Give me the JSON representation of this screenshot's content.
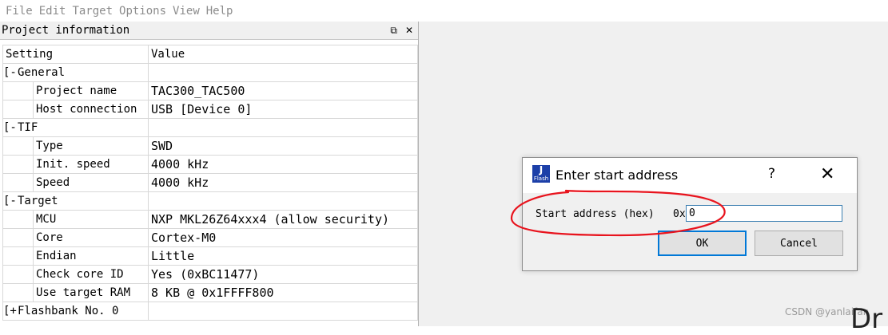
{
  "menu": [
    "File",
    "Edit",
    "Target",
    "Options",
    "View",
    "Help"
  ],
  "panel": {
    "title": "Project information",
    "restore_glyph": "⧉",
    "close_glyph": "✕"
  },
  "table": {
    "headers": [
      "Setting",
      "Value"
    ],
    "groups": [
      {
        "expander": "[-",
        "label": "General",
        "rows": [
          {
            "key": "Project name",
            "value": "TAC300_TAC500"
          },
          {
            "key": "Host connection",
            "value": "USB [Device 0]"
          }
        ]
      },
      {
        "expander": "[-",
        "label": "TIF",
        "rows": [
          {
            "key": "Type",
            "value": "SWD"
          },
          {
            "key": "Init. speed",
            "value": "4000 kHz"
          },
          {
            "key": "Speed",
            "value": "4000 kHz"
          }
        ]
      },
      {
        "expander": "[-",
        "label": "Target",
        "rows": [
          {
            "key": "MCU",
            "value": "NXP MKL26Z64xxx4 (allow security)"
          },
          {
            "key": "Core",
            "value": "Cortex-M0"
          },
          {
            "key": "Endian",
            "value": "Little"
          },
          {
            "key": "Check core ID",
            "value": "Yes (0xBC11477)"
          },
          {
            "key": "Use target RAM",
            "value": "8 KB @ 0x1FFFF800"
          }
        ]
      },
      {
        "expander": "[+",
        "label": "Flashbank No. 0",
        "rows": []
      }
    ]
  },
  "dialog": {
    "title": "Enter start address",
    "icon_top": "J",
    "icon_bottom": "Flash",
    "help": "?",
    "close": "✕",
    "label": "Start address (hex)",
    "prefix": "0x",
    "value": "0",
    "ok": "OK",
    "cancel": "Cancel"
  },
  "watermark": "CSDN @yanlaifan",
  "partial_text": "Dr",
  "colors": {
    "annotation": "#e8141e",
    "focus": "#0078d7"
  }
}
